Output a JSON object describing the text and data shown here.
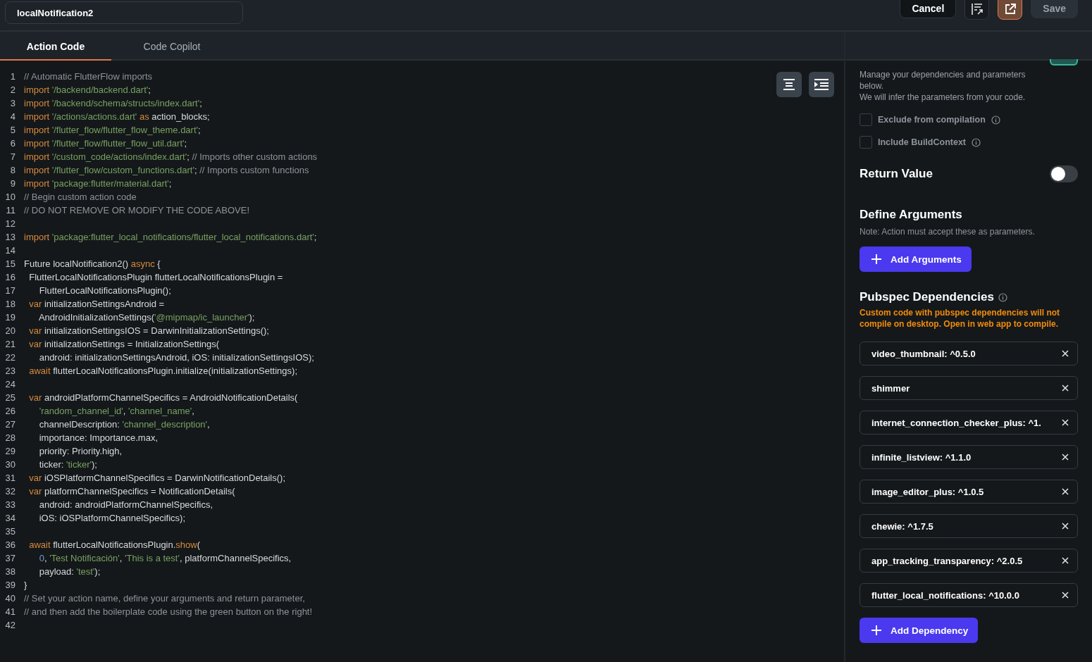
{
  "header": {
    "name_field": {
      "value": "localNotification2"
    },
    "buttons": [
      {
        "kind": "text",
        "label": "Cancel",
        "disabled": false
      },
      {
        "kind": "format",
        "disabled": false
      },
      {
        "kind": "external",
        "disabled": false
      },
      {
        "kind": "text",
        "label": "Save",
        "disabled": true
      }
    ]
  },
  "tabs": [
    {
      "label": "Action Code",
      "selected": true
    },
    {
      "label": "Code Copilot",
      "selected": false
    }
  ],
  "editor": {
    "tools": [
      {
        "kind": "center"
      },
      {
        "kind": "indent"
      }
    ],
    "lines": [
      {
        "number": "1",
        "tokens": [
          {
            "kind": "comment",
            "text": "// Automatic FlutterFlow imports"
          }
        ]
      },
      {
        "number": "2",
        "tokens": [
          {
            "kind": "keyword",
            "text": "import "
          },
          {
            "kind": "string",
            "text": "'/backend/backend.dart'"
          },
          {
            "kind": "plain",
            "text": ";"
          }
        ]
      },
      {
        "number": "3",
        "tokens": [
          {
            "kind": "keyword",
            "text": "import "
          },
          {
            "kind": "string",
            "text": "'/backend/schema/structs/index.dart'"
          },
          {
            "kind": "plain",
            "text": ";"
          }
        ]
      },
      {
        "number": "4",
        "tokens": [
          {
            "kind": "keyword",
            "text": "import "
          },
          {
            "kind": "string",
            "text": "'/actions/actions.dart' "
          },
          {
            "kind": "keyword",
            "text": "as "
          },
          {
            "kind": "plain",
            "text": "action_blocks;"
          }
        ]
      },
      {
        "number": "5",
        "tokens": [
          {
            "kind": "keyword",
            "text": "import "
          },
          {
            "kind": "string",
            "text": "'/flutter_flow/flutter_flow_theme.dart'"
          },
          {
            "kind": "plain",
            "text": ";"
          }
        ]
      },
      {
        "number": "6",
        "tokens": [
          {
            "kind": "keyword",
            "text": "import "
          },
          {
            "kind": "string",
            "text": "'/flutter_flow/flutter_flow_util.dart'"
          },
          {
            "kind": "plain",
            "text": ";"
          }
        ]
      },
      {
        "number": "7",
        "tokens": [
          {
            "kind": "keyword",
            "text": "import "
          },
          {
            "kind": "string",
            "text": "'/custom_code/actions/index.dart'"
          },
          {
            "kind": "plain",
            "text": "; "
          },
          {
            "kind": "comment",
            "text": "// Imports other custom actions"
          }
        ]
      },
      {
        "number": "8",
        "tokens": [
          {
            "kind": "keyword",
            "text": "import "
          },
          {
            "kind": "string",
            "text": "'/flutter_flow/custom_functions.dart'"
          },
          {
            "kind": "plain",
            "text": "; "
          },
          {
            "kind": "comment",
            "text": "// Imports custom functions"
          }
        ]
      },
      {
        "number": "9",
        "tokens": [
          {
            "kind": "keyword",
            "text": "import "
          },
          {
            "kind": "string",
            "text": "'package:flutter/material.dart'"
          },
          {
            "kind": "plain",
            "text": ";"
          }
        ]
      },
      {
        "number": "10",
        "tokens": [
          {
            "kind": "comment",
            "text": "// Begin custom action code"
          }
        ]
      },
      {
        "number": "11",
        "tokens": [
          {
            "kind": "comment",
            "text": "// DO NOT REMOVE OR MODIFY THE CODE ABOVE!"
          }
        ]
      },
      {
        "number": "12"
      },
      {
        "number": "13",
        "tokens": [
          {
            "kind": "keyword",
            "text": "import "
          },
          {
            "kind": "string",
            "text": "'package:flutter_local_notifications/flutter_local_notifications.dart'"
          },
          {
            "kind": "plain",
            "text": ";"
          }
        ]
      },
      {
        "number": "14"
      },
      {
        "number": "15",
        "tokens": [
          {
            "kind": "plain",
            "text": "Future localNotification2() "
          },
          {
            "kind": "keyword",
            "text": "async "
          },
          {
            "kind": "plain",
            "text": "{"
          }
        ]
      },
      {
        "number": "16",
        "tokens": [
          {
            "kind": "plain",
            "text": "  FlutterLocalNotificationsPlugin flutterLocalNotificationsPlugin ="
          }
        ]
      },
      {
        "number": "17",
        "tokens": [
          {
            "kind": "plain",
            "text": "      FlutterLocalNotificationsPlugin();"
          }
        ]
      },
      {
        "number": "18",
        "tokens": [
          {
            "kind": "keyword",
            "text": "  var "
          },
          {
            "kind": "plain",
            "text": "initializationSettingsAndroid ="
          }
        ]
      },
      {
        "number": "19",
        "tokens": [
          {
            "kind": "plain",
            "text": "      AndroidInitializationSettings("
          },
          {
            "kind": "string",
            "text": "'@mipmap/ic_launcher'"
          },
          {
            "kind": "plain",
            "text": ");"
          }
        ]
      },
      {
        "number": "20",
        "tokens": [
          {
            "kind": "keyword",
            "text": "  var "
          },
          {
            "kind": "plain",
            "text": "initializationSettingsIOS = DarwinInitializationSettings();"
          }
        ]
      },
      {
        "number": "21",
        "tokens": [
          {
            "kind": "keyword",
            "text": "  var "
          },
          {
            "kind": "plain",
            "text": "initializationSettings = InitializationSettings("
          }
        ]
      },
      {
        "number": "22",
        "tokens": [
          {
            "kind": "plain",
            "text": "      android: initializationSettingsAndroid, iOS: initializationSettingsIOS);"
          }
        ]
      },
      {
        "number": "23",
        "tokens": [
          {
            "kind": "keyword",
            "text": "  await "
          },
          {
            "kind": "plain",
            "text": "flutterLocalNotificationsPlugin.initialize(initializationSettings);"
          }
        ]
      },
      {
        "number": "24"
      },
      {
        "number": "25",
        "tokens": [
          {
            "kind": "keyword",
            "text": "  var "
          },
          {
            "kind": "plain",
            "text": "androidPlatformChannelSpecifics = AndroidNotificationDetails("
          }
        ]
      },
      {
        "number": "26",
        "tokens": [
          {
            "kind": "string",
            "text": "      'random_channel_id'"
          },
          {
            "kind": "plain",
            "text": ", "
          },
          {
            "kind": "string",
            "text": "'channel_name'"
          },
          {
            "kind": "plain",
            "text": ","
          }
        ]
      },
      {
        "number": "27",
        "tokens": [
          {
            "kind": "plain",
            "text": "      channelDescription: "
          },
          {
            "kind": "string",
            "text": "'channel_description'"
          },
          {
            "kind": "plain",
            "text": ","
          }
        ]
      },
      {
        "number": "28",
        "tokens": [
          {
            "kind": "plain",
            "text": "      importance: Importance.max,"
          }
        ]
      },
      {
        "number": "29",
        "tokens": [
          {
            "kind": "plain",
            "text": "      priority: Priority.high,"
          }
        ]
      },
      {
        "number": "30",
        "tokens": [
          {
            "kind": "plain",
            "text": "      ticker: "
          },
          {
            "kind": "string",
            "text": "'ticker'"
          },
          {
            "kind": "plain",
            "text": ");"
          }
        ]
      },
      {
        "number": "31",
        "tokens": [
          {
            "kind": "keyword",
            "text": "  var "
          },
          {
            "kind": "plain",
            "text": "iOSPlatformChannelSpecifics = DarwinNotificationDetails();"
          }
        ]
      },
      {
        "number": "32",
        "tokens": [
          {
            "kind": "keyword",
            "text": "  var "
          },
          {
            "kind": "plain",
            "text": "platformChannelSpecifics = NotificationDetails("
          }
        ]
      },
      {
        "number": "33",
        "tokens": [
          {
            "kind": "plain",
            "text": "      android: androidPlatformChannelSpecifics,"
          }
        ]
      },
      {
        "number": "34",
        "tokens": [
          {
            "kind": "plain",
            "text": "      iOS: iOSPlatformChannelSpecifics);"
          }
        ]
      },
      {
        "number": "35"
      },
      {
        "number": "36",
        "tokens": [
          {
            "kind": "keyword",
            "text": "  await "
          },
          {
            "kind": "plain",
            "text": "flutterLocalNotificationsPlugin."
          },
          {
            "kind": "keyword",
            "text": "show"
          },
          {
            "kind": "plain",
            "text": "("
          }
        ]
      },
      {
        "number": "37",
        "tokens": [
          {
            "kind": "number",
            "text": "      0"
          },
          {
            "kind": "plain",
            "text": ", "
          },
          {
            "kind": "string",
            "text": "'Test Notificación'"
          },
          {
            "kind": "plain",
            "text": ", "
          },
          {
            "kind": "string",
            "text": "'This is a test'"
          },
          {
            "kind": "plain",
            "text": ", platformChannelSpecifics,"
          }
        ]
      },
      {
        "number": "38",
        "tokens": [
          {
            "kind": "plain",
            "text": "      payload: "
          },
          {
            "kind": "string",
            "text": "'test'"
          },
          {
            "kind": "plain",
            "text": ");"
          }
        ]
      },
      {
        "number": "39",
        "tokens": [
          {
            "kind": "plain",
            "text": "}"
          }
        ]
      },
      {
        "number": "40",
        "tokens": [
          {
            "kind": "comment",
            "text": "// Set your action name, define your arguments and return parameter,"
          }
        ]
      },
      {
        "number": "41",
        "tokens": [
          {
            "kind": "comment",
            "text": "// and then add the boilerplate code using the green button on the right!"
          }
        ]
      },
      {
        "number": "42"
      }
    ]
  },
  "panel": {
    "intro": [
      "Manage your dependencies and parameters below.",
      "We will infer the parameters from your code."
    ],
    "options": [
      {
        "label": "Exclude from compilation",
        "checked": false
      },
      {
        "label": "Include BuildContext",
        "checked": false
      }
    ],
    "return_value": {
      "label": "Return Value",
      "on": false
    },
    "arguments": {
      "title": "Define Arguments",
      "note": "Note: Action must accept these as parameters.",
      "button": "Add Arguments"
    },
    "dependencies": {
      "title": "Pubspec Dependencies",
      "warning": "Custom code with pubspec dependencies will not compile on desktop. Open in web app to compile.",
      "items": [
        {
          "name": "video_thumbnail: ^0.5.0"
        },
        {
          "name": "shimmer"
        },
        {
          "name": "internet_connection_checker_plus: ^1."
        },
        {
          "name": "infinite_listview: ^1.1.0"
        },
        {
          "name": "image_editor_plus: ^1.0.5"
        },
        {
          "name": "chewie: ^1.7.5"
        },
        {
          "name": "app_tracking_transparency: ^2.0.5"
        },
        {
          "name": "flutter_local_notifications: ^10.0.0"
        }
      ],
      "button": "Add Dependency"
    }
  }
}
